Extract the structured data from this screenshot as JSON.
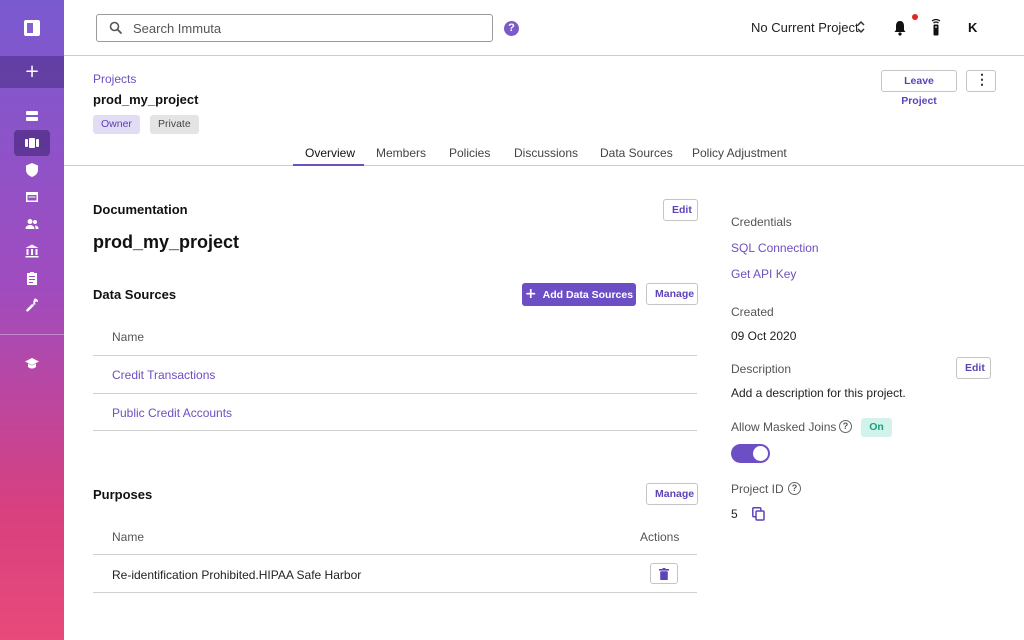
{
  "topbar": {
    "search_placeholder": "Search Immuta",
    "help": "?",
    "current_project": "No Current Project",
    "avatar_initial": "K"
  },
  "sidebar": {
    "add": "+",
    "items": [
      "list-icon",
      "projects-icon",
      "shield-icon",
      "data-table-icon",
      "users-icon",
      "institution-icon",
      "clipboard-icon",
      "wrench-icon",
      "graduation-cap-icon"
    ],
    "active_item": "projects-icon"
  },
  "project": {
    "breadcrumb": "Projects",
    "title": "prod_my_project",
    "badges": [
      "Owner",
      "Private"
    ],
    "leave_label": "Leave Project",
    "more_label": "⋮"
  },
  "tabs": [
    {
      "label": "Overview",
      "active": true
    },
    {
      "label": "Members"
    },
    {
      "label": "Policies"
    },
    {
      "label": "Discussions"
    },
    {
      "label": "Data Sources"
    },
    {
      "label": "Policy Adjustment"
    }
  ],
  "documentation": {
    "title": "Documentation",
    "edit_label": "Edit",
    "heading": "prod_my_project"
  },
  "data_sources": {
    "title": "Data Sources",
    "add_label": "Add Data Sources",
    "manage_label": "Manage",
    "column_name": "Name",
    "rows": [
      "Credit Transactions",
      "Public Credit Accounts"
    ]
  },
  "purposes": {
    "title": "Purposes",
    "manage_label": "Manage",
    "column_name": "Name",
    "column_actions": "Actions",
    "rows": [
      "Re-identification Prohibited.HIPAA Safe Harbor"
    ]
  },
  "details": {
    "credentials_label": "Credentials",
    "sql_link": "SQL Connection",
    "api_link": "Get API Key",
    "created_label": "Created",
    "created_value": "09 Oct 2020",
    "description_label": "Description",
    "description_edit": "Edit",
    "description_value": "Add a description for this project.",
    "masked_joins_label": "Allow Masked Joins",
    "masked_joins_status": "On",
    "project_id_label": "Project ID",
    "project_id_value": "5"
  },
  "colors": {
    "accent": "#6c4fc4",
    "link": "#6e4fc0",
    "on_badge_bg": "#d2f3ec",
    "on_badge_text": "#18a080"
  }
}
